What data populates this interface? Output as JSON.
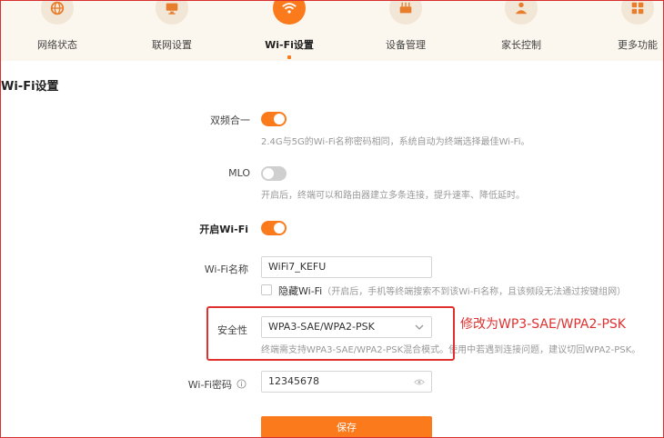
{
  "nav": [
    {
      "label": "网络状态",
      "icon": "globe-icon",
      "active": false
    },
    {
      "label": "联网设置",
      "icon": "monitor-icon",
      "active": false
    },
    {
      "label": "Wi-Fi设置",
      "icon": "wifi-icon",
      "active": true
    },
    {
      "label": "设备管理",
      "icon": "router-icon",
      "active": false
    },
    {
      "label": "家长控制",
      "icon": "parent-icon",
      "active": false
    },
    {
      "label": "更多功能",
      "icon": "grid-icon",
      "active": false
    }
  ],
  "page_title": "Wi-Fi设置",
  "dual_band": {
    "label": "双频合一",
    "on": true,
    "hint": "2.4G与5G的Wi-Fi名称密码相同，系统自动为终端选择最佳Wi-Fi。"
  },
  "mlo": {
    "label": "MLO",
    "on": false,
    "hint": "开启后，终端可以和路由器建立多条连接，提升速率、降低延时。"
  },
  "wifi_enable": {
    "label": "开启Wi-Fi",
    "on": true
  },
  "wifi_name": {
    "label": "Wi-Fi名称",
    "value": "WiFi7_KEFU"
  },
  "hide_wifi": {
    "label": "隐藏Wi-Fi",
    "hint": "（开启后，手机等终端搜索不到该Wi-Fi名称，且该频段无法通过按键组网）"
  },
  "security": {
    "label": "安全性",
    "value": "WPA3-SAE/WPA2-PSK",
    "hint": "终端需支持WPA3-SAE/WPA2-PSK混合模式。使用中若遇到连接问题，建议切回WPA2-PSK。"
  },
  "password": {
    "label": "Wi-Fi密码",
    "value": "12345678"
  },
  "annotation": "修改为WP3-SAE/WPA2-PSK",
  "save_label": "保存",
  "colors": {
    "accent": "#fb7a1c",
    "annotation": "#e0312f",
    "nav_bg": "#fbf6ee"
  }
}
